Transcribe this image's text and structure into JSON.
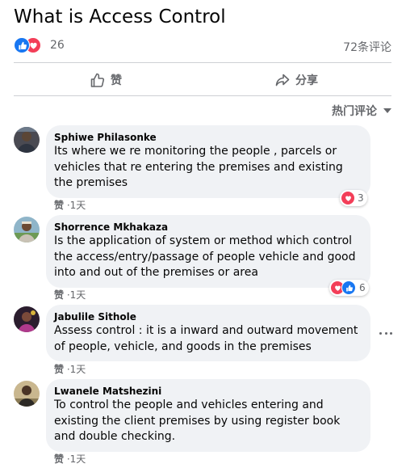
{
  "post": {
    "title": "What is Access Control",
    "reaction_count": "26",
    "comment_count": "72条评论"
  },
  "actions": {
    "like_label": "赞",
    "share_label": "分享"
  },
  "sort": {
    "label": "热门评论"
  },
  "colors": {
    "like_blue": "#1877f2",
    "love_red": "#f33e58",
    "bubble_bg": "#f0f2f5",
    "muted_text": "#65676b"
  },
  "comments": [
    {
      "name": "Sphiwe Philasonke",
      "text": "Its where we re monitoring the people , parcels or vehicles that re entering the premises and existing the premises",
      "like_label": "赞",
      "time": "1天",
      "reactions": [
        "love"
      ],
      "reaction_count": "3"
    },
    {
      "name": "Shorrence Mkhakaza",
      "text": "Is the application of system or method which control the access/entry/passage of people vehicle and good into and out of the premises or area",
      "like_label": "赞",
      "time": "1天",
      "reactions": [
        "love",
        "like"
      ],
      "reaction_count": "6"
    },
    {
      "name": "Jabulile Sithole",
      "text": "Assess control : it is a inward and outward movement of people, vehicle, and goods in the premises",
      "like_label": "赞",
      "time": "1天"
    },
    {
      "name": "Lwanele Matshezini",
      "text": "To control the people and vehicles entering and existing the client premises by using register book and double checking.",
      "like_label": "赞",
      "time": "1天"
    }
  ]
}
